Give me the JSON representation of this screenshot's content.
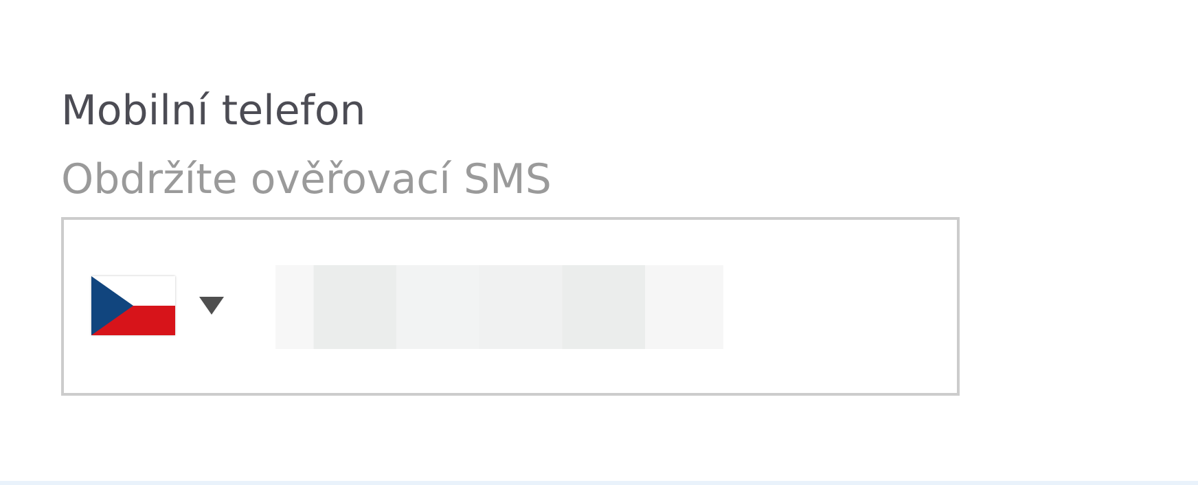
{
  "phone_field": {
    "label": "Mobilní telefon",
    "hint": "Obdržíte ověřovací SMS",
    "country": {
      "flag_icon": "czech-flag-icon",
      "caret_icon": "caret-down-icon"
    },
    "number_value": ""
  },
  "colors": {
    "label": "#4c4c54",
    "hint": "#9a9a9a",
    "border": "#cccccc",
    "flag_blue": "#11457e",
    "flag_red": "#d7141a",
    "caret": "#4f4f4f"
  }
}
